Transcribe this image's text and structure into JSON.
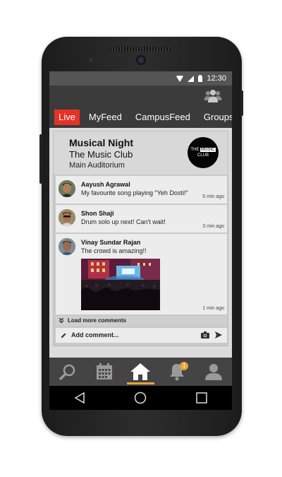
{
  "status_bar": {
    "time": "12:30"
  },
  "tabs": [
    {
      "label": "Live",
      "active": true
    },
    {
      "label": "MyFeed"
    },
    {
      "label": "CampusFeed"
    },
    {
      "label": "Groups"
    }
  ],
  "event": {
    "title": "Musical Night",
    "club": "The Music Club",
    "venue": "Main Auditorium",
    "logo": {
      "top": "THE",
      "highlight": "MUSIC",
      "bottom": "CLUB"
    }
  },
  "comments": [
    {
      "name": "Aayush Agrawal",
      "text": "My favourite song playing \"Yeh Dosti!\"",
      "time": "5 min ago"
    },
    {
      "name": "Shon Shaji",
      "text": "Drum solo up next! Can't wait!",
      "time": "3 min ago"
    },
    {
      "name": "Vinay Sundar Rajan",
      "text": "The crowd is amazing!!",
      "time": "1 min ago"
    }
  ],
  "load_more_label": "Load more comments",
  "add_comment_placeholder": "Add comment...",
  "nav": {
    "notification_count": "1",
    "active": "home"
  },
  "colors": {
    "accent_red": "#e53227",
    "accent_orange": "#e8a33a",
    "bar_dark": "#3b3b3b"
  }
}
